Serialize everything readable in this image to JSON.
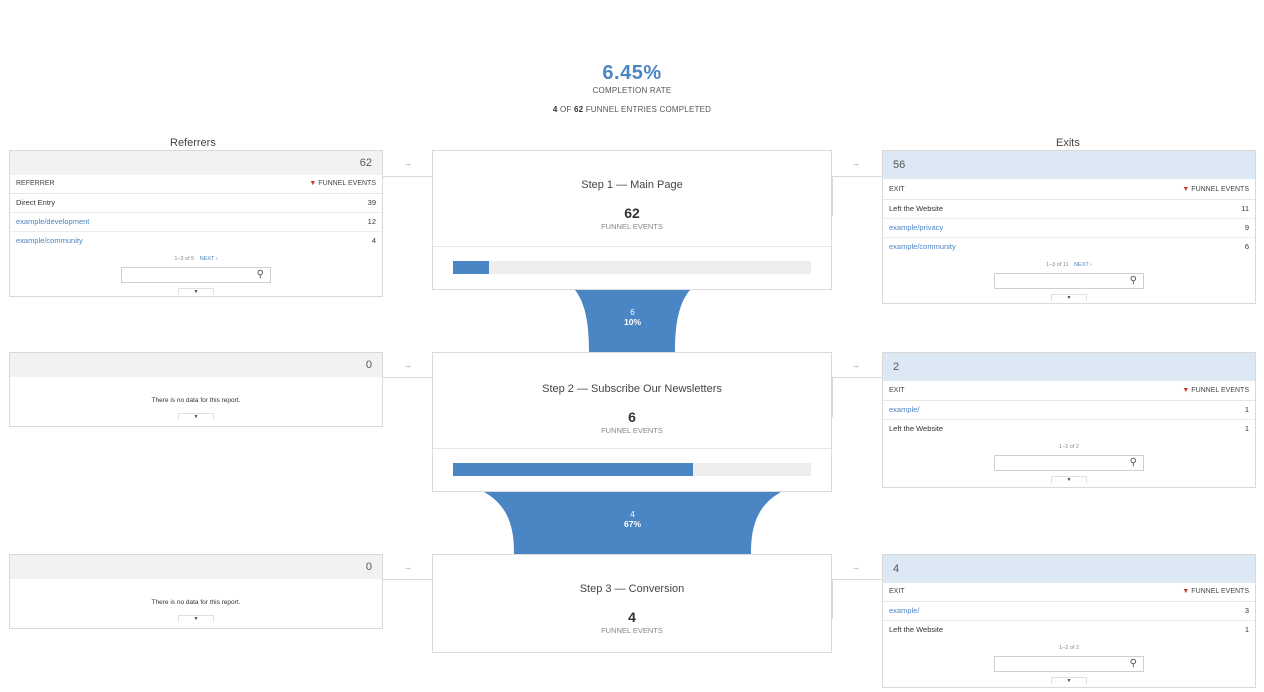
{
  "summary": {
    "rate": "6.45%",
    "rate_label": "COMPLETION RATE",
    "completed": "4",
    "of_label": "OF",
    "entries": "62",
    "entries_label": "FUNNEL ENTRIES COMPLETED"
  },
  "columns": {
    "left": "Referrers",
    "right": "Exits"
  },
  "arrow": "→",
  "referrers": [
    {
      "total": "62",
      "header_left": "REFERRER",
      "header_right": "FUNNEL EVENTS",
      "rows": [
        {
          "name": "Direct Entry",
          "value": "39",
          "link": false
        },
        {
          "name": "example/development",
          "value": "12",
          "link": true
        },
        {
          "name": "example/community",
          "value": "4",
          "link": true
        }
      ],
      "pager": "1–3 of 5",
      "next": "NEXT ›"
    },
    {
      "total": "0",
      "nodata": "There is no data for this report."
    },
    {
      "total": "0",
      "nodata": "There is no data for this report."
    }
  ],
  "steps": [
    {
      "title": "Step 1 — Main Page",
      "count": "62",
      "label": "FUNNEL EVENTS",
      "progress": 0.1
    },
    {
      "title": "Step 2 — Subscribe Our Newsletters",
      "count": "6",
      "label": "FUNNEL EVENTS",
      "progress": 0.67
    },
    {
      "title": "Step 3 — Conversion",
      "count": "4",
      "label": "FUNNEL EVENTS"
    }
  ],
  "flows": [
    {
      "count": "6",
      "pct": "10%"
    },
    {
      "count": "4",
      "pct": "67%"
    }
  ],
  "exits": [
    {
      "total": "56",
      "header_left": "EXIT",
      "header_right": "FUNNEL EVENTS",
      "rows": [
        {
          "name": "Left the Website",
          "value": "11",
          "link": false
        },
        {
          "name": "example/privacy",
          "value": "9",
          "link": true
        },
        {
          "name": "example/community",
          "value": "6",
          "link": true
        }
      ],
      "pager": "1–3 of 11",
      "next": "NEXT ›"
    },
    {
      "total": "2",
      "header_left": "EXIT",
      "header_right": "FUNNEL EVENTS",
      "rows": [
        {
          "name": "example/",
          "value": "1",
          "link": true
        },
        {
          "name": "Left the Website",
          "value": "1",
          "link": false
        }
      ],
      "pager": "1–2 of 2"
    },
    {
      "total": "4",
      "header_left": "EXIT",
      "header_right": "FUNNEL EVENTS",
      "rows": [
        {
          "name": "example/",
          "value": "3",
          "link": true
        },
        {
          "name": "Left the Website",
          "value": "1",
          "link": false
        }
      ],
      "pager": "1–2 of 2"
    }
  ],
  "colors": {
    "accent": "#4a85c4",
    "sort_indicator": "#d0342c",
    "exit_header": "#dce8f3"
  },
  "icons": {
    "search": "search-icon",
    "sort": "sort-desc-icon",
    "expand": "chevron-down-icon"
  }
}
